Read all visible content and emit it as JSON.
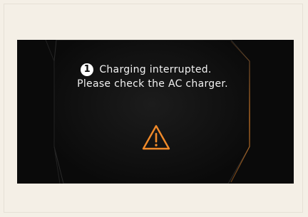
{
  "notification": {
    "badge_number": "1",
    "line1": "Charging interrupted.",
    "line2": "Please check the AC charger."
  },
  "icons": {
    "badge": "number-one-circle-icon",
    "warning": "warning-triangle-icon"
  },
  "colors": {
    "page_background": "#f4efe6",
    "screen_background": "#0a0a0a",
    "accent": "#f08a2a",
    "text": "#f2f2f2"
  }
}
